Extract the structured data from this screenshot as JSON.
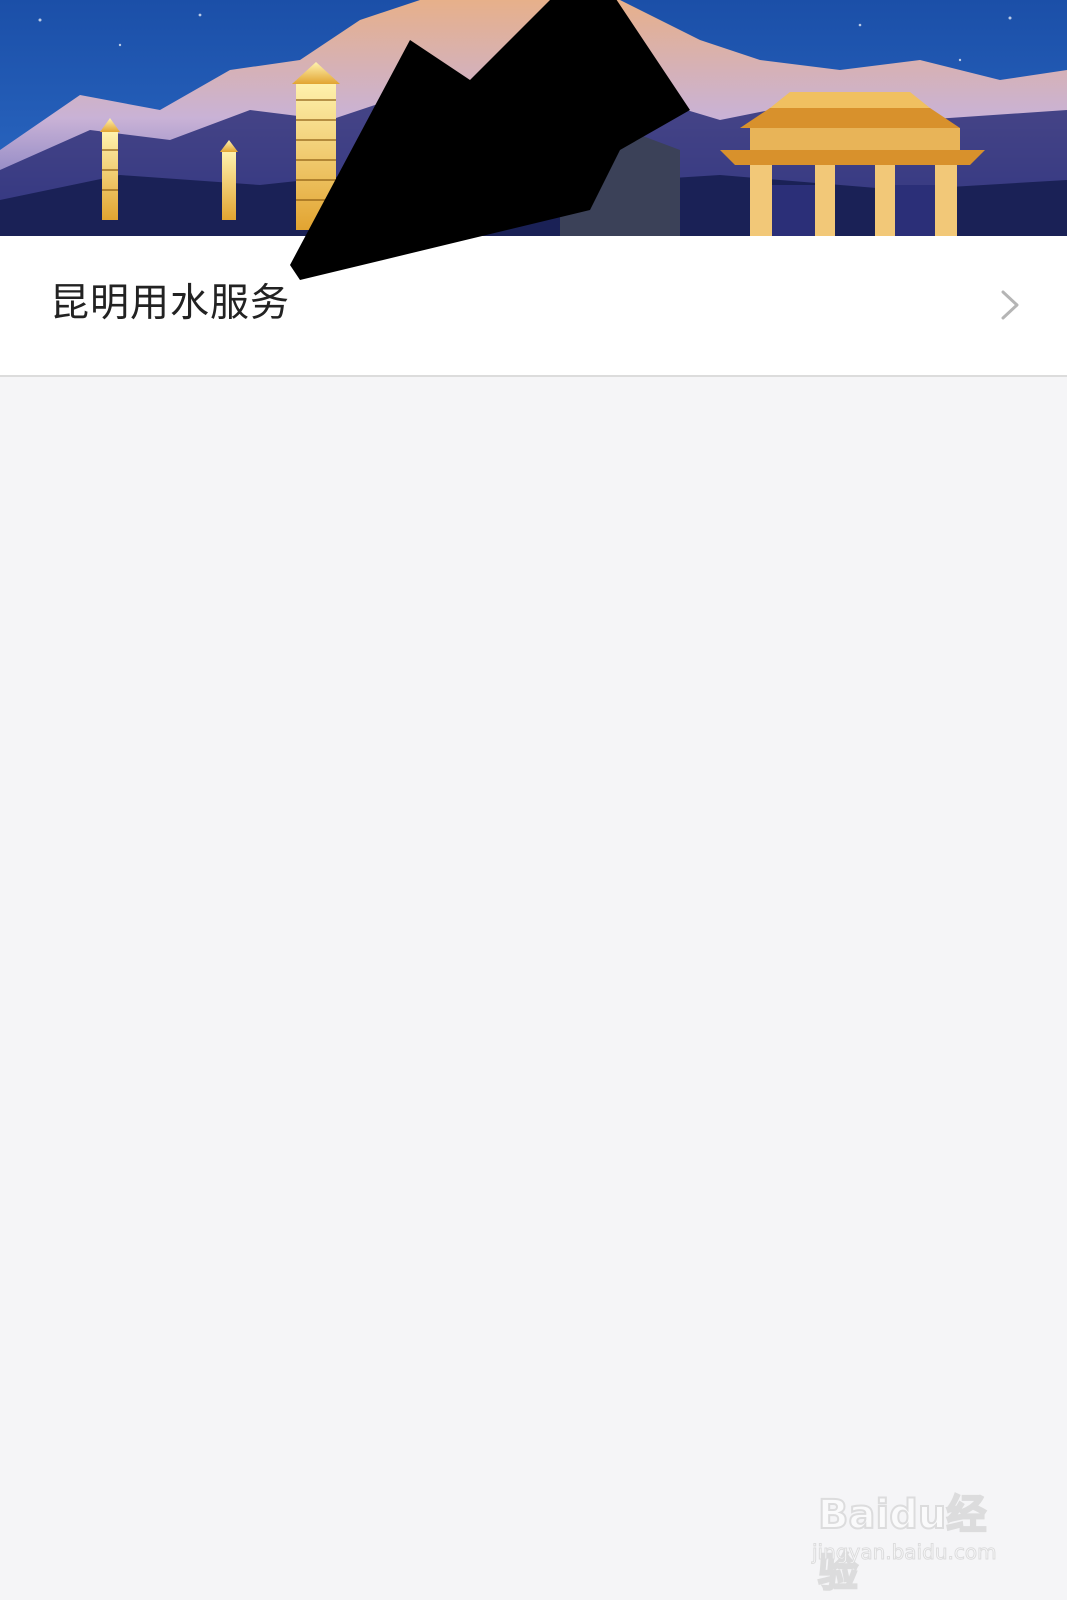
{
  "banner": {
    "image": "night-mountain-pagodas-archway"
  },
  "service_item": {
    "label": "昆明用水服务",
    "icon": "chevron-right-icon"
  },
  "watermark": {
    "brand_latin": "Bai",
    "brand_mid": "du",
    "brand_cn": "经验",
    "url": "jingyan.baidu.com"
  },
  "colors": {
    "page_bg": "#f5f5f7",
    "row_bg": "#ffffff",
    "label": "#222222",
    "chevron": "#b5b5b5",
    "arrow": "#000000"
  }
}
